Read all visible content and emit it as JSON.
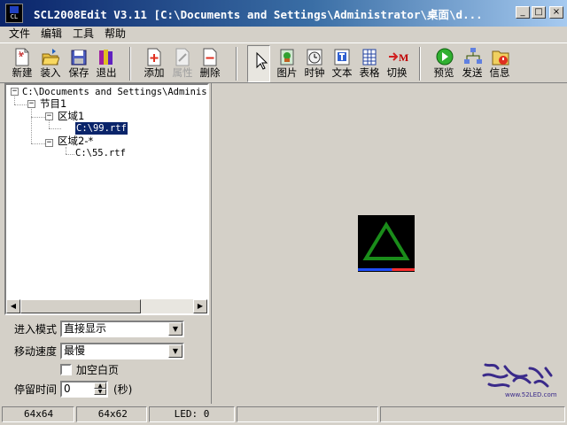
{
  "window": {
    "title": "SCL2008Edit V3.11 [C:\\Documents and Settings\\Administrator\\桌面\\d...",
    "icon_text": "CL"
  },
  "caption_buttons": {
    "minimize": "_",
    "maximize": "□",
    "close": "×"
  },
  "menu": [
    "文件",
    "编辑",
    "工具",
    "帮助"
  ],
  "toolbar": {
    "new": "新建",
    "load": "装入",
    "save": "保存",
    "exit": "退出",
    "add": "添加",
    "properties": "属性",
    "delete": "删除",
    "picture": "图片",
    "clock": "时钟",
    "text": "文本",
    "table": "表格",
    "switch": "切换",
    "preview": "预览",
    "send": "发送",
    "info": "信息"
  },
  "tree": {
    "root": "C:\\Documents and Settings\\Administ",
    "program": "节目1",
    "area1": "区域1",
    "area1_file": "C:\\99.rtf",
    "area2": "区域2-*",
    "area2_file": "C:\\55.rtf"
  },
  "props": {
    "enter_mode_label": "进入模式",
    "enter_mode_value": "直接显示",
    "speed_label": "移动速度",
    "speed_value": "最慢",
    "blank_page_label": "加空白页",
    "blank_page_checked": false,
    "stay_label": "停留时间",
    "stay_value": "0",
    "stay_unit": "(秒)"
  },
  "canvas": {
    "led_bg": "#000000",
    "triangle_color": "#1a8c1a"
  },
  "watermark": {
    "text": "www.52LED.com"
  },
  "status": {
    "pane1": "64x64",
    "pane2": "64x62",
    "pane3": "LED: 0",
    "pane4": "",
    "pane5": ""
  }
}
